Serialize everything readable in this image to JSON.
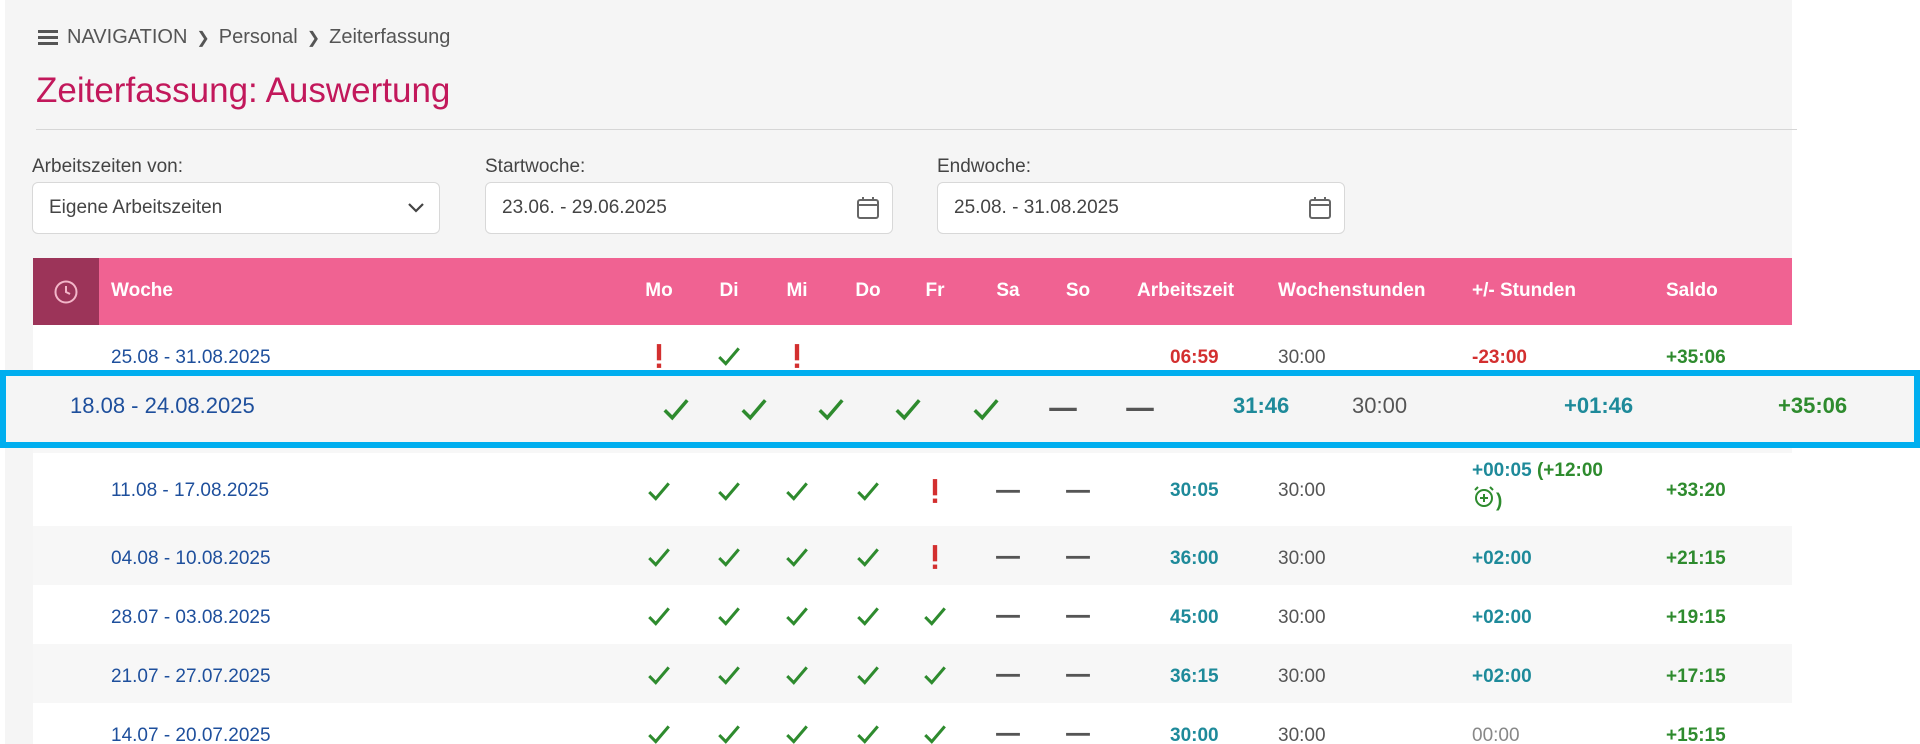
{
  "breadcrumb": {
    "nav": "NAVIGATION",
    "personal": "Personal",
    "current": "Zeiterfassung"
  },
  "page_title": "Zeiterfassung: Auswertung",
  "filters": {
    "arbeitszeiten_label": "Arbeitszeiten von:",
    "arbeitszeiten_value": "Eigene Arbeitszeiten",
    "startwoche_label": "Startwoche:",
    "startwoche_value": "23.06. - 29.06.2025",
    "endwoche_label": "Endwoche:",
    "endwoche_value": "25.08. - 31.08.2025"
  },
  "table": {
    "headers": {
      "woche": "Woche",
      "mo": "Mo",
      "di": "Di",
      "mi": "Mi",
      "do": "Do",
      "fr": "Fr",
      "sa": "Sa",
      "so": "So",
      "arbeitszeit": "Arbeitszeit",
      "wochenstunden": "Wochenstunden",
      "plusminus": "+/- Stunden",
      "saldo": "Saldo"
    },
    "rows": [
      {
        "week": "25.08 - 31.08.2025",
        "days": [
          "warning",
          "check",
          "warning",
          "",
          "",
          "",
          ""
        ],
        "arbeitszeit": "06:59",
        "wochenstunden": "30:00",
        "plusminus": "-23:00",
        "saldo": "+35:06"
      },
      {
        "week": "18.08 - 24.08.2025",
        "days": [
          "check",
          "check",
          "check",
          "check",
          "check",
          "dash",
          "dash"
        ],
        "arbeitszeit": "31:46",
        "wochenstunden": "30:00",
        "plusminus": "+01:46",
        "saldo": "+35:06"
      },
      {
        "week": "11.08 - 17.08.2025",
        "days": [
          "check",
          "check",
          "check",
          "check",
          "warning",
          "dash",
          "dash"
        ],
        "arbeitszeit": "30:05",
        "wochenstunden": "30:00",
        "plusminus": "+00:05",
        "plusminus_extra": "(+12:00",
        "plusminus_extra_close": ")",
        "saldo": "+33:20"
      },
      {
        "week": "04.08 - 10.08.2025",
        "days": [
          "check",
          "check",
          "check",
          "check",
          "warning",
          "dash",
          "dash"
        ],
        "arbeitszeit": "36:00",
        "wochenstunden": "30:00",
        "plusminus": "+02:00",
        "saldo": "+21:15"
      },
      {
        "week": "28.07 - 03.08.2025",
        "days": [
          "check",
          "check",
          "check",
          "check",
          "check",
          "dash",
          "dash"
        ],
        "arbeitszeit": "45:00",
        "wochenstunden": "30:00",
        "plusminus": "+02:00",
        "saldo": "+19:15"
      },
      {
        "week": "21.07 - 27.07.2025",
        "days": [
          "check",
          "check",
          "check",
          "check",
          "check",
          "dash",
          "dash"
        ],
        "arbeitszeit": "36:15",
        "wochenstunden": "30:00",
        "plusminus": "+02:00",
        "saldo": "+17:15"
      },
      {
        "week": "14.07 - 20.07.2025",
        "days": [
          "check",
          "check",
          "check",
          "check",
          "check",
          "dash",
          "dash"
        ],
        "arbeitszeit": "30:00",
        "wochenstunden": "30:00",
        "plusminus": "00:00",
        "saldo": "+15:15"
      }
    ]
  },
  "colors": {
    "accent": "#c2185b",
    "header": "#f06292",
    "highlight": "#00aeef",
    "check": "#2e8b2e",
    "warning": "#d32f2f"
  }
}
